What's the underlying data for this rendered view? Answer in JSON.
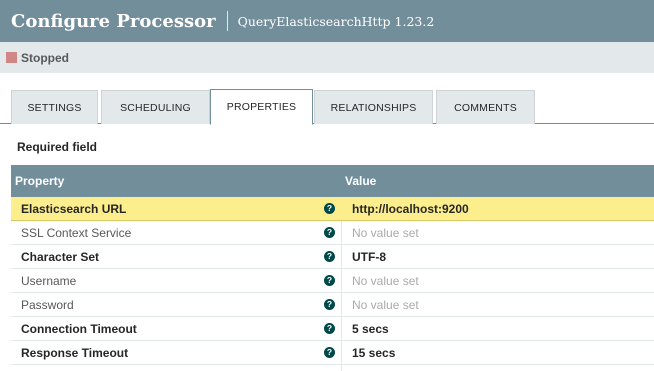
{
  "header": {
    "title": "Configure Processor",
    "subtitle": "QueryElasticsearchHttp 1.23.2"
  },
  "status": {
    "label": "Stopped",
    "color": "#d18686"
  },
  "tabs": [
    {
      "label": "SETTINGS",
      "active": false
    },
    {
      "label": "SCHEDULING",
      "active": false
    },
    {
      "label": "PROPERTIES",
      "active": true
    },
    {
      "label": "RELATIONSHIPS",
      "active": false
    },
    {
      "label": "COMMENTS",
      "active": false
    }
  ],
  "properties": {
    "required_label": "Required field",
    "columns": {
      "property": "Property",
      "value": "Value"
    },
    "help_icon": "question-circle-icon",
    "rows": [
      {
        "name": "Elasticsearch URL",
        "required": true,
        "value": "http://localhost:9200",
        "value_set": true
      },
      {
        "name": "SSL Context Service",
        "required": false,
        "value": "No value set",
        "value_set": false
      },
      {
        "name": "Character Set",
        "required": true,
        "value": "UTF-8",
        "value_set": true
      },
      {
        "name": "Username",
        "required": false,
        "value": "No value set",
        "value_set": false
      },
      {
        "name": "Password",
        "required": false,
        "value": "No value set",
        "value_set": false
      },
      {
        "name": "Connection Timeout",
        "required": true,
        "value": "5 secs",
        "value_set": true
      },
      {
        "name": "Response Timeout",
        "required": true,
        "value": "15 secs",
        "value_set": true
      }
    ]
  },
  "colors": {
    "header_bg": "#728e9b",
    "status_bg": "#e3e8eb",
    "highlight_row": "#fcee8c",
    "help_icon": "#004849"
  }
}
